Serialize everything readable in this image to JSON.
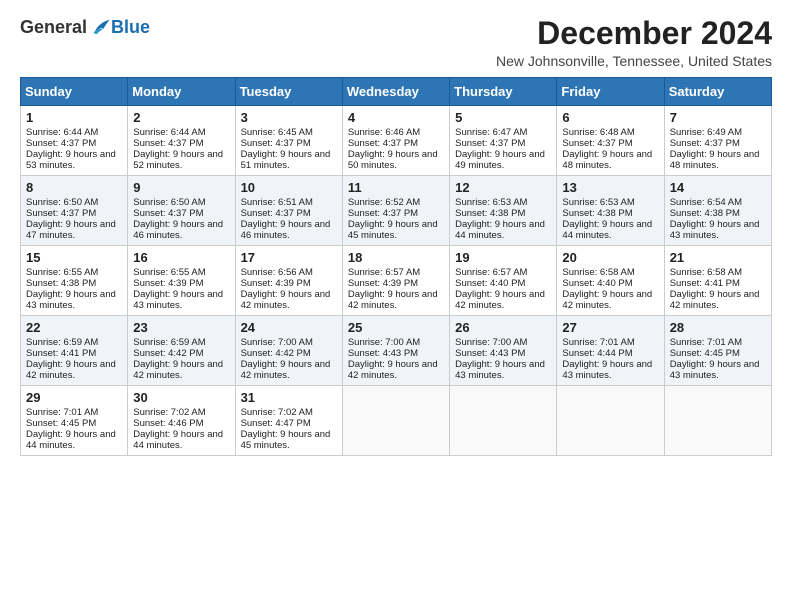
{
  "header": {
    "logo_general": "General",
    "logo_blue": "Blue",
    "month_title": "December 2024",
    "location": "New Johnsonville, Tennessee, United States"
  },
  "weekdays": [
    "Sunday",
    "Monday",
    "Tuesday",
    "Wednesday",
    "Thursday",
    "Friday",
    "Saturday"
  ],
  "weeks": [
    [
      {
        "day": "1",
        "sunrise": "6:44 AM",
        "sunset": "4:37 PM",
        "daylight": "9 hours and 53 minutes."
      },
      {
        "day": "2",
        "sunrise": "6:44 AM",
        "sunset": "4:37 PM",
        "daylight": "9 hours and 52 minutes."
      },
      {
        "day": "3",
        "sunrise": "6:45 AM",
        "sunset": "4:37 PM",
        "daylight": "9 hours and 51 minutes."
      },
      {
        "day": "4",
        "sunrise": "6:46 AM",
        "sunset": "4:37 PM",
        "daylight": "9 hours and 50 minutes."
      },
      {
        "day": "5",
        "sunrise": "6:47 AM",
        "sunset": "4:37 PM",
        "daylight": "9 hours and 49 minutes."
      },
      {
        "day": "6",
        "sunrise": "6:48 AM",
        "sunset": "4:37 PM",
        "daylight": "9 hours and 48 minutes."
      },
      {
        "day": "7",
        "sunrise": "6:49 AM",
        "sunset": "4:37 PM",
        "daylight": "9 hours and 48 minutes."
      }
    ],
    [
      {
        "day": "8",
        "sunrise": "6:50 AM",
        "sunset": "4:37 PM",
        "daylight": "9 hours and 47 minutes."
      },
      {
        "day": "9",
        "sunrise": "6:50 AM",
        "sunset": "4:37 PM",
        "daylight": "9 hours and 46 minutes."
      },
      {
        "day": "10",
        "sunrise": "6:51 AM",
        "sunset": "4:37 PM",
        "daylight": "9 hours and 46 minutes."
      },
      {
        "day": "11",
        "sunrise": "6:52 AM",
        "sunset": "4:37 PM",
        "daylight": "9 hours and 45 minutes."
      },
      {
        "day": "12",
        "sunrise": "6:53 AM",
        "sunset": "4:38 PM",
        "daylight": "9 hours and 44 minutes."
      },
      {
        "day": "13",
        "sunrise": "6:53 AM",
        "sunset": "4:38 PM",
        "daylight": "9 hours and 44 minutes."
      },
      {
        "day": "14",
        "sunrise": "6:54 AM",
        "sunset": "4:38 PM",
        "daylight": "9 hours and 43 minutes."
      }
    ],
    [
      {
        "day": "15",
        "sunrise": "6:55 AM",
        "sunset": "4:38 PM",
        "daylight": "9 hours and 43 minutes."
      },
      {
        "day": "16",
        "sunrise": "6:55 AM",
        "sunset": "4:39 PM",
        "daylight": "9 hours and 43 minutes."
      },
      {
        "day": "17",
        "sunrise": "6:56 AM",
        "sunset": "4:39 PM",
        "daylight": "9 hours and 42 minutes."
      },
      {
        "day": "18",
        "sunrise": "6:57 AM",
        "sunset": "4:39 PM",
        "daylight": "9 hours and 42 minutes."
      },
      {
        "day": "19",
        "sunrise": "6:57 AM",
        "sunset": "4:40 PM",
        "daylight": "9 hours and 42 minutes."
      },
      {
        "day": "20",
        "sunrise": "6:58 AM",
        "sunset": "4:40 PM",
        "daylight": "9 hours and 42 minutes."
      },
      {
        "day": "21",
        "sunrise": "6:58 AM",
        "sunset": "4:41 PM",
        "daylight": "9 hours and 42 minutes."
      }
    ],
    [
      {
        "day": "22",
        "sunrise": "6:59 AM",
        "sunset": "4:41 PM",
        "daylight": "9 hours and 42 minutes."
      },
      {
        "day": "23",
        "sunrise": "6:59 AM",
        "sunset": "4:42 PM",
        "daylight": "9 hours and 42 minutes."
      },
      {
        "day": "24",
        "sunrise": "7:00 AM",
        "sunset": "4:42 PM",
        "daylight": "9 hours and 42 minutes."
      },
      {
        "day": "25",
        "sunrise": "7:00 AM",
        "sunset": "4:43 PM",
        "daylight": "9 hours and 42 minutes."
      },
      {
        "day": "26",
        "sunrise": "7:00 AM",
        "sunset": "4:43 PM",
        "daylight": "9 hours and 43 minutes."
      },
      {
        "day": "27",
        "sunrise": "7:01 AM",
        "sunset": "4:44 PM",
        "daylight": "9 hours and 43 minutes."
      },
      {
        "day": "28",
        "sunrise": "7:01 AM",
        "sunset": "4:45 PM",
        "daylight": "9 hours and 43 minutes."
      }
    ],
    [
      {
        "day": "29",
        "sunrise": "7:01 AM",
        "sunset": "4:45 PM",
        "daylight": "9 hours and 44 minutes."
      },
      {
        "day": "30",
        "sunrise": "7:02 AM",
        "sunset": "4:46 PM",
        "daylight": "9 hours and 44 minutes."
      },
      {
        "day": "31",
        "sunrise": "7:02 AM",
        "sunset": "4:47 PM",
        "daylight": "9 hours and 45 minutes."
      },
      null,
      null,
      null,
      null
    ]
  ]
}
